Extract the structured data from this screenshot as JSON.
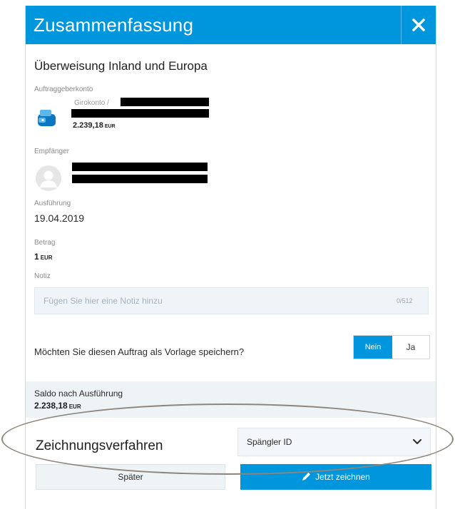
{
  "dialog": {
    "title": "Zusammenfassung",
    "close_icon": "close-icon"
  },
  "transfer": {
    "type": "Überweisung Inland und Europa"
  },
  "sender": {
    "label": "Auftraggeberkonto",
    "account_name": "Girokonto /",
    "balance_amount": "2.239,18",
    "balance_currency": "EUR",
    "icon": "wallet-icon"
  },
  "recipient": {
    "label": "Empfänger",
    "icon": "avatar-icon"
  },
  "execution": {
    "label": "Ausführung",
    "date": "19.04.2019"
  },
  "amount": {
    "label": "Betrag",
    "value": "1",
    "currency": "EUR"
  },
  "note": {
    "label": "Notiz",
    "placeholder": "Fügen Sie hier eine Notiz hinzu",
    "value": "",
    "counter": "0/512"
  },
  "template": {
    "question": "Möchten Sie diesen Auftrag als Vorlage speichern?",
    "no_label": "Nein",
    "yes_label": "Ja",
    "selected": "Nein"
  },
  "balance_after": {
    "label": "Saldo nach Ausführung",
    "amount": "2.238,18",
    "currency": "EUR"
  },
  "signing": {
    "label": "Zeichnungsverfahren",
    "selected_option": "Spängler ID",
    "chevron_icon": "chevron-down-icon"
  },
  "actions": {
    "later_label": "Später",
    "sign_label": "Jetzt zeichnen",
    "sign_icon": "pen-icon"
  },
  "colors": {
    "accent": "#0096de",
    "panel_background": "#eef3f6",
    "annotation_ellipse": "#8d847c"
  }
}
